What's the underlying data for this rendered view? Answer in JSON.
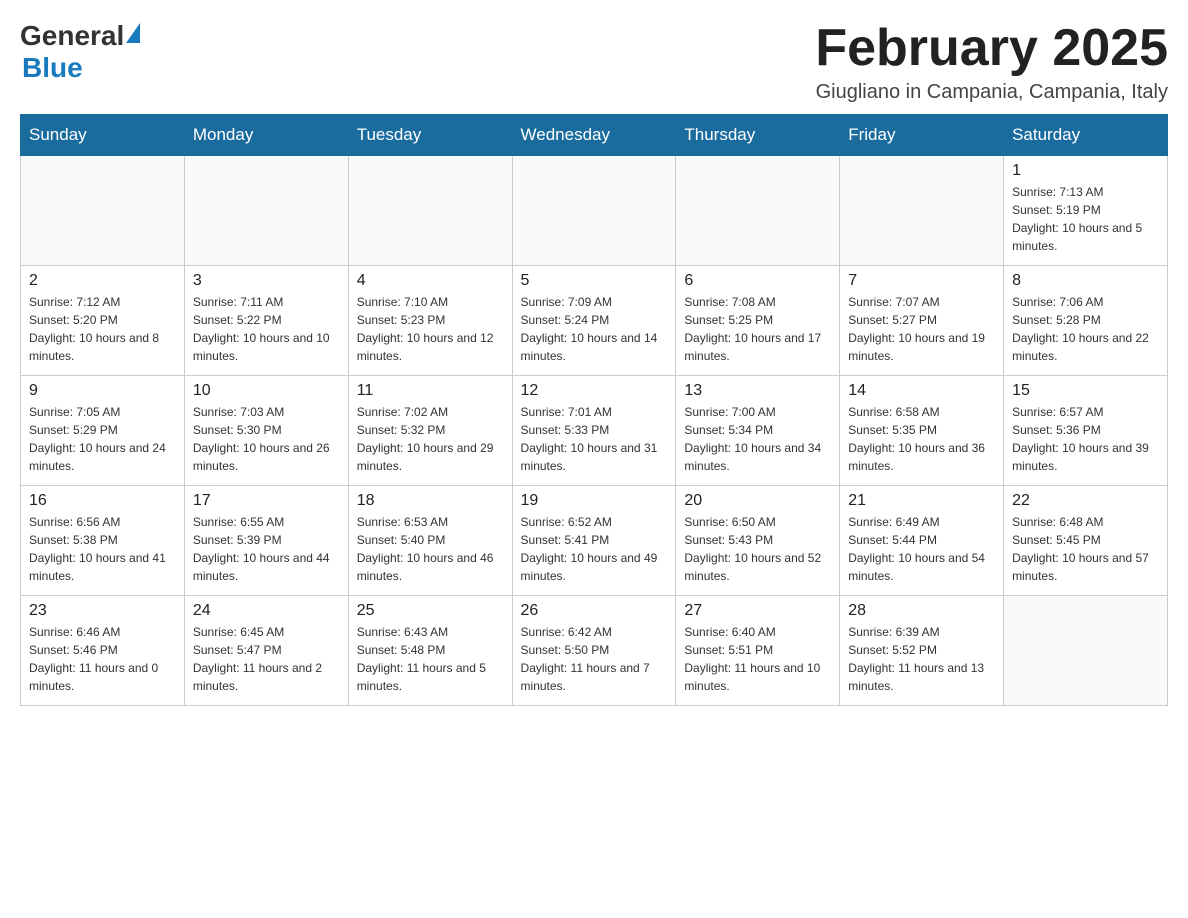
{
  "header": {
    "logo": {
      "general": "General",
      "blue": "Blue"
    },
    "title": "February 2025",
    "location": "Giugliano in Campania, Campania, Italy"
  },
  "days_of_week": [
    "Sunday",
    "Monday",
    "Tuesday",
    "Wednesday",
    "Thursday",
    "Friday",
    "Saturday"
  ],
  "weeks": [
    [
      {
        "day": "",
        "info": ""
      },
      {
        "day": "",
        "info": ""
      },
      {
        "day": "",
        "info": ""
      },
      {
        "day": "",
        "info": ""
      },
      {
        "day": "",
        "info": ""
      },
      {
        "day": "",
        "info": ""
      },
      {
        "day": "1",
        "info": "Sunrise: 7:13 AM\nSunset: 5:19 PM\nDaylight: 10 hours and 5 minutes."
      }
    ],
    [
      {
        "day": "2",
        "info": "Sunrise: 7:12 AM\nSunset: 5:20 PM\nDaylight: 10 hours and 8 minutes."
      },
      {
        "day": "3",
        "info": "Sunrise: 7:11 AM\nSunset: 5:22 PM\nDaylight: 10 hours and 10 minutes."
      },
      {
        "day": "4",
        "info": "Sunrise: 7:10 AM\nSunset: 5:23 PM\nDaylight: 10 hours and 12 minutes."
      },
      {
        "day": "5",
        "info": "Sunrise: 7:09 AM\nSunset: 5:24 PM\nDaylight: 10 hours and 14 minutes."
      },
      {
        "day": "6",
        "info": "Sunrise: 7:08 AM\nSunset: 5:25 PM\nDaylight: 10 hours and 17 minutes."
      },
      {
        "day": "7",
        "info": "Sunrise: 7:07 AM\nSunset: 5:27 PM\nDaylight: 10 hours and 19 minutes."
      },
      {
        "day": "8",
        "info": "Sunrise: 7:06 AM\nSunset: 5:28 PM\nDaylight: 10 hours and 22 minutes."
      }
    ],
    [
      {
        "day": "9",
        "info": "Sunrise: 7:05 AM\nSunset: 5:29 PM\nDaylight: 10 hours and 24 minutes."
      },
      {
        "day": "10",
        "info": "Sunrise: 7:03 AM\nSunset: 5:30 PM\nDaylight: 10 hours and 26 minutes."
      },
      {
        "day": "11",
        "info": "Sunrise: 7:02 AM\nSunset: 5:32 PM\nDaylight: 10 hours and 29 minutes."
      },
      {
        "day": "12",
        "info": "Sunrise: 7:01 AM\nSunset: 5:33 PM\nDaylight: 10 hours and 31 minutes."
      },
      {
        "day": "13",
        "info": "Sunrise: 7:00 AM\nSunset: 5:34 PM\nDaylight: 10 hours and 34 minutes."
      },
      {
        "day": "14",
        "info": "Sunrise: 6:58 AM\nSunset: 5:35 PM\nDaylight: 10 hours and 36 minutes."
      },
      {
        "day": "15",
        "info": "Sunrise: 6:57 AM\nSunset: 5:36 PM\nDaylight: 10 hours and 39 minutes."
      }
    ],
    [
      {
        "day": "16",
        "info": "Sunrise: 6:56 AM\nSunset: 5:38 PM\nDaylight: 10 hours and 41 minutes."
      },
      {
        "day": "17",
        "info": "Sunrise: 6:55 AM\nSunset: 5:39 PM\nDaylight: 10 hours and 44 minutes."
      },
      {
        "day": "18",
        "info": "Sunrise: 6:53 AM\nSunset: 5:40 PM\nDaylight: 10 hours and 46 minutes."
      },
      {
        "day": "19",
        "info": "Sunrise: 6:52 AM\nSunset: 5:41 PM\nDaylight: 10 hours and 49 minutes."
      },
      {
        "day": "20",
        "info": "Sunrise: 6:50 AM\nSunset: 5:43 PM\nDaylight: 10 hours and 52 minutes."
      },
      {
        "day": "21",
        "info": "Sunrise: 6:49 AM\nSunset: 5:44 PM\nDaylight: 10 hours and 54 minutes."
      },
      {
        "day": "22",
        "info": "Sunrise: 6:48 AM\nSunset: 5:45 PM\nDaylight: 10 hours and 57 minutes."
      }
    ],
    [
      {
        "day": "23",
        "info": "Sunrise: 6:46 AM\nSunset: 5:46 PM\nDaylight: 11 hours and 0 minutes."
      },
      {
        "day": "24",
        "info": "Sunrise: 6:45 AM\nSunset: 5:47 PM\nDaylight: 11 hours and 2 minutes."
      },
      {
        "day": "25",
        "info": "Sunrise: 6:43 AM\nSunset: 5:48 PM\nDaylight: 11 hours and 5 minutes."
      },
      {
        "day": "26",
        "info": "Sunrise: 6:42 AM\nSunset: 5:50 PM\nDaylight: 11 hours and 7 minutes."
      },
      {
        "day": "27",
        "info": "Sunrise: 6:40 AM\nSunset: 5:51 PM\nDaylight: 11 hours and 10 minutes."
      },
      {
        "day": "28",
        "info": "Sunrise: 6:39 AM\nSunset: 5:52 PM\nDaylight: 11 hours and 13 minutes."
      },
      {
        "day": "",
        "info": ""
      }
    ]
  ]
}
